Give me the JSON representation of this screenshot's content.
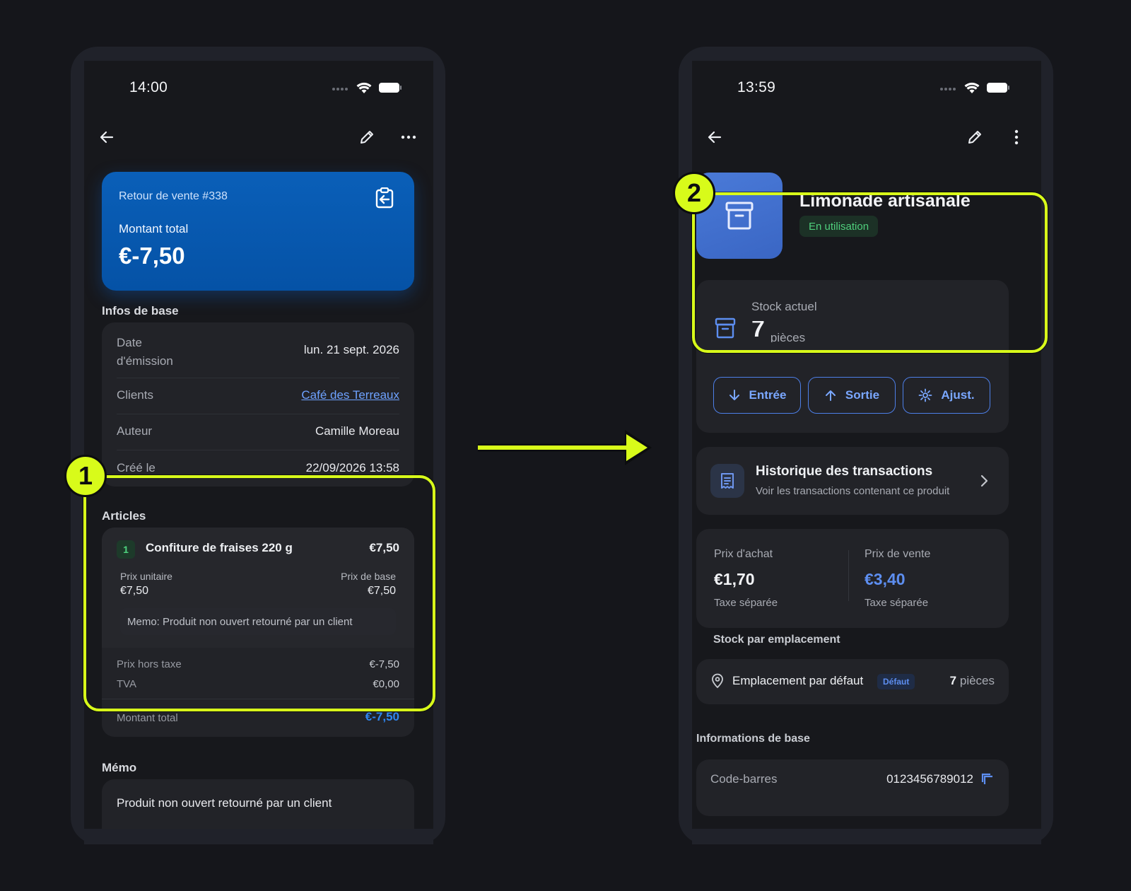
{
  "colors": {
    "accent_highlight": "#d8fb1a",
    "primary_blue": "#0a5fb8",
    "link_blue": "#6ea2ff",
    "success_green": "#4fcf7c",
    "background": "#15161b"
  },
  "left_screen": {
    "status_time": "14:00",
    "nav": {
      "back_icon": "arrow-left-icon",
      "edit_icon": "pencil-icon",
      "more_icon": "more-horizontal-icon"
    },
    "header_card": {
      "title": "Retour de vente #338",
      "label": "Montant total",
      "amount": "€-7,50",
      "icon": "return-clipboard-icon"
    },
    "basic_info": {
      "section_title": "Infos de base",
      "rows": [
        {
          "label": "Date\nd'émission",
          "value": "lun. 21 sept. 2026"
        },
        {
          "label": "Clients",
          "value": "Café des Terreaux"
        },
        {
          "label": "Auteur",
          "value": "Camille Moreau"
        },
        {
          "label": "Créé le",
          "value": "22/09/2026 13:58"
        }
      ]
    },
    "articles": {
      "section_title": "Articles",
      "item": {
        "index": "1",
        "name": "Confiture de fraises 220 g",
        "price": "€7,50",
        "unit_price_label": "Prix unitaire",
        "unit_price": "€7,50",
        "base_price_label": "Prix de base",
        "base_price": "€7,50",
        "memo": "Memo: Produit non ouvert retourné par un client"
      },
      "subtotal_label": "Prix hors taxe",
      "subtotal": "€-7,50",
      "tax_label": "TVA",
      "tax": "€0,00",
      "total_label": "Montant total",
      "total": "€-7,50"
    },
    "memo": {
      "section_title": "Mémo",
      "text": "Produit non ouvert retourné par un client"
    }
  },
  "right_screen": {
    "status_time": "13:59",
    "nav": {
      "back_icon": "arrow-left-icon",
      "edit_icon": "pencil-icon",
      "more_icon": "more-vertical-icon"
    },
    "product": {
      "name": "Limonade artisanale",
      "status": "En utilisation",
      "thumb_icon": "archive-box-icon"
    },
    "stock": {
      "label": "Stock actuel",
      "value": "7",
      "unit": "pièces",
      "buttons": [
        {
          "label": "Entrée",
          "icon": "arrow-down-icon"
        },
        {
          "label": "Sortie",
          "icon": "arrow-up-icon"
        },
        {
          "label": "Ajust.",
          "icon": "gear-icon"
        }
      ]
    },
    "history": {
      "title": "Historique des transactions",
      "subtitle": "Voir les transactions contenant ce produit",
      "icon": "receipt-icon"
    },
    "prices": {
      "purchase_label": "Prix d'achat",
      "purchase": "€1,70",
      "purchase_note": "Taxe séparée",
      "sale_label": "Prix de vente",
      "sale": "€3,40",
      "sale_note": "Taxe séparée"
    },
    "stock_by_location": {
      "section_title": "Stock par emplacement",
      "location": "Emplacement par défaut",
      "tag": "Défaut",
      "qty": "7",
      "unit": "pièces"
    },
    "basic_info": {
      "section_title": "Informations de base",
      "barcode_label": "Code-barres",
      "barcode": "0123456789012"
    }
  },
  "annotations": {
    "step1": "1",
    "step2": "2"
  }
}
